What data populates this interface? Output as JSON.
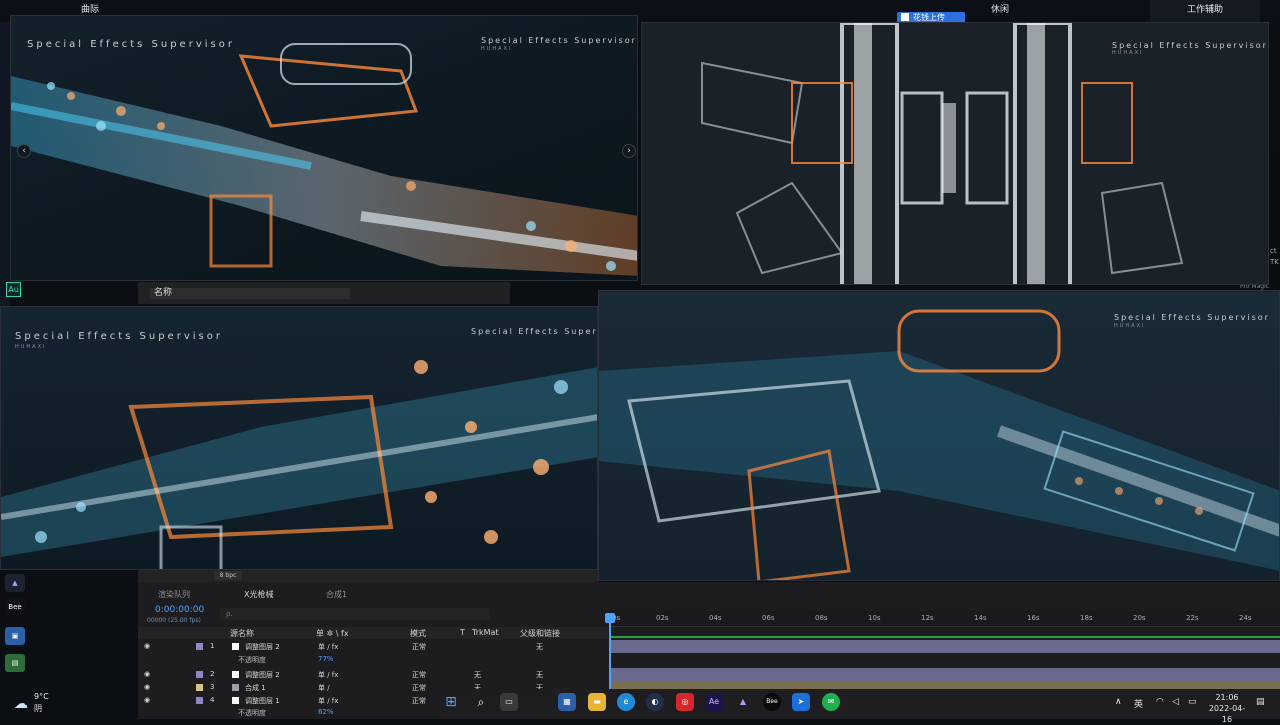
{
  "desktop": {
    "topbar": {
      "item1": "曲际",
      "search_btn": "花钱上传",
      "item2": "休闲",
      "item3": "工作辅助"
    },
    "right_strip": [
      "ct",
      "TK"
    ],
    "right_label": "Pro Magic"
  },
  "panels": {
    "panel1": {
      "title": "Special Effects Supervisor",
      "sub": "HUHAXI",
      "title2": "Special Effects Supervisor",
      "sub2": "HUHAXI"
    },
    "panel2": {
      "title": "Special Effects Supervisor",
      "sub": "HUHAXI"
    },
    "panel3": {
      "title": "Special Effects Supervisor",
      "sub": "HUHAXI",
      "title2": "Special Effects Supervi"
    },
    "panel4": {
      "title": "Special Effects Supervisor",
      "sub": "HUHAXI"
    },
    "prev_icon": "chevron-left-icon",
    "next_icon": "chevron-right-icon"
  },
  "project": {
    "au_label": "Au",
    "name_header": "名称",
    "bpc": "8 bpc"
  },
  "ae": {
    "tabs": [
      "渲染队列",
      "X光枪械",
      "合成1"
    ],
    "timecode": "0:00:00:00",
    "fps": "00000 (25.00 fps)",
    "search_placeholder": "ρ.",
    "columns": {
      "source": "源名称",
      "switches": "单 ✲ \\ fx",
      "mode": "模式",
      "t": "T",
      "trkmat": "TrkMat",
      "parent": "父级和链接"
    },
    "layers": [
      {
        "num": "1",
        "name": "调整图层 2",
        "mode": "正常",
        "trkmat": "",
        "parent": "无",
        "color": "#8e86c9"
      },
      {
        "num": "2",
        "name": "调整图层 2",
        "mode": "正常",
        "trkmat": "无",
        "parent": "无",
        "color": "#8e86c9"
      },
      {
        "num": "3",
        "name": "合成 1",
        "mode": "正常",
        "trkmat": "无",
        "parent": "无",
        "color": "#d6c48a"
      },
      {
        "num": "4",
        "name": "调整图层 1",
        "mode": "正常",
        "trkmat": "无",
        "parent": "无",
        "color": "#8e86c9"
      }
    ],
    "opacity_label": "不透明度",
    "opacity_1": "77%",
    "opacity_4": "62%",
    "ruler": [
      "0s",
      "02s",
      "04s",
      "06s",
      "08s",
      "10s",
      "12s",
      "14s",
      "16s",
      "18s",
      "20s",
      "22s",
      "24s"
    ]
  },
  "taskbar": {
    "weather_temp": "9°C",
    "weather_desc": "阴",
    "ime": "英",
    "time": "21:06",
    "date": "2022-04-16",
    "apps": [
      "start-icon",
      "search-icon",
      "task-view-icon",
      "store-icon",
      "folder-icon",
      "edge-icon",
      "cinema4d-icon",
      "netease-music-icon",
      "after-effects-icon",
      "pictures-icon",
      "bee-icon",
      "feishu-icon",
      "wechat-icon"
    ],
    "ae_label": "Ae",
    "bee_label": "Bee"
  },
  "left_icons": {
    "bee": "Bee"
  },
  "colors": {
    "accent": "#4da3ff",
    "orange": "#ff8a3a",
    "cyan": "#4fd6ff"
  }
}
